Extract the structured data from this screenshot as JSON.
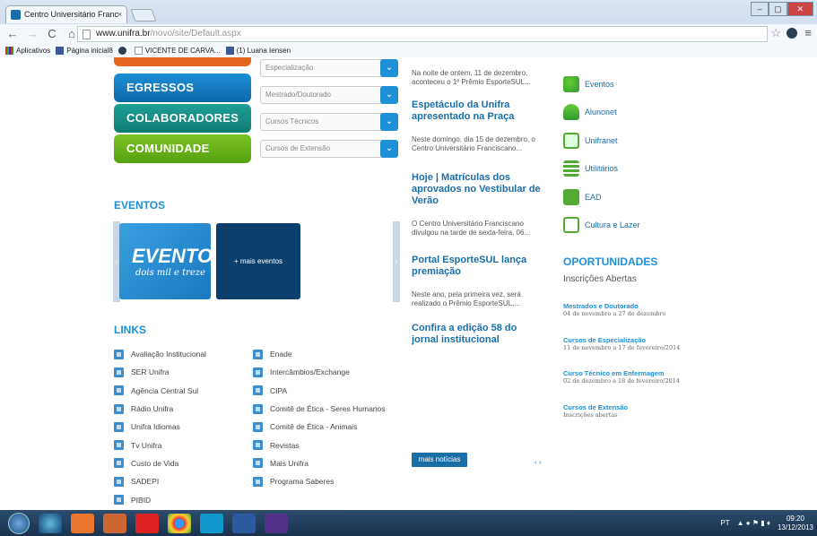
{
  "browser": {
    "tab_title": "Centro Universitário Franc",
    "tab_close": "×",
    "url_host": "www.unifra.br",
    "url_path": "/novo/site/Default.aspx",
    "bookmarks": [
      "Aplicativos",
      "Página inicial8",
      "VICENTE DE CARVA...",
      "(1) Luana Iensen"
    ],
    "win_min": "–",
    "win_max": "▢",
    "win_close": "✕"
  },
  "left": {
    "buttons": [
      "EGRESSOS",
      "COLABORADORES",
      "COMUNIDADE"
    ],
    "selects": [
      "Especialização",
      "Mestrado/Doutorado",
      "Cursos Técnicos",
      "Cursos de Extensão"
    ]
  },
  "events": {
    "heading": "EVENTOS",
    "card_big": "EVENTOS",
    "card_small": "dois mil e treze",
    "more": "+ mais eventos"
  },
  "links": {
    "heading": "LINKS",
    "col1": [
      "Avaliação Institucional",
      "SER Unifra",
      "Agência Central Sul",
      "Rádio Unifra",
      "Unifra Idiomas",
      "Tv Unifra",
      "Custo de Vida",
      "SADEPI",
      "PIBID"
    ],
    "col2": [
      "Enade",
      "Intercâmbios/Exchange",
      "CIPA",
      "Comitê de Ética - Seres Humanos",
      "Comitê de Ética - Animais",
      "Revistas",
      "Mais Unifra",
      "Programa Saberes"
    ]
  },
  "news": {
    "items": [
      {
        "summary": "Na noite de ontem, 11 de dezembro, aconteceu o 1º Prêmio EsporteSUL..."
      },
      {
        "title": "Espetáculo da Unifra apresentado na Praça",
        "summary": "Neste domingo, dia 15 de dezembro, o Centro Universitário Franciscano..."
      },
      {
        "title": "Hoje | Matrículas dos aprovados no Vestibular de Verão",
        "summary": "O Centro Universitário Franciscano divulgou na tarde de sexta-feira, 06..."
      },
      {
        "title": "Portal EsporteSUL lança premiação",
        "summary": "Neste ano, pela primeira vez, será realizado o Prêmio EsporteSUL,..."
      },
      {
        "title": "Confira a edição 58 do jornal institucional"
      }
    ],
    "more_button": "mais notícias",
    "pager": "‹ ›"
  },
  "right": {
    "links": [
      "Eventos",
      "Alunonet",
      "Unifranet",
      "Utilitários",
      "EAD",
      "Cultura e Lazer"
    ],
    "heading": "OPORTUNIDADES",
    "subheading": "Inscrições Abertas",
    "opportunities": [
      {
        "title": "Mestrados e Doutorado",
        "dates": "04 de novembro a 27 de dezembro"
      },
      {
        "title": "Cursos de Especialização",
        "dates": "11 de novembro a 17 de fevereiro/2014"
      },
      {
        "title": "Curso Técnico em Enfermagem",
        "dates": "02 de dezembro a 18 de fevereiro/2014"
      },
      {
        "title": "Cursos de Extensão",
        "dates": "Inscrições abertas"
      }
    ]
  },
  "taskbar": {
    "lang": "PT",
    "time": "09:20",
    "date": "13/12/2013"
  }
}
